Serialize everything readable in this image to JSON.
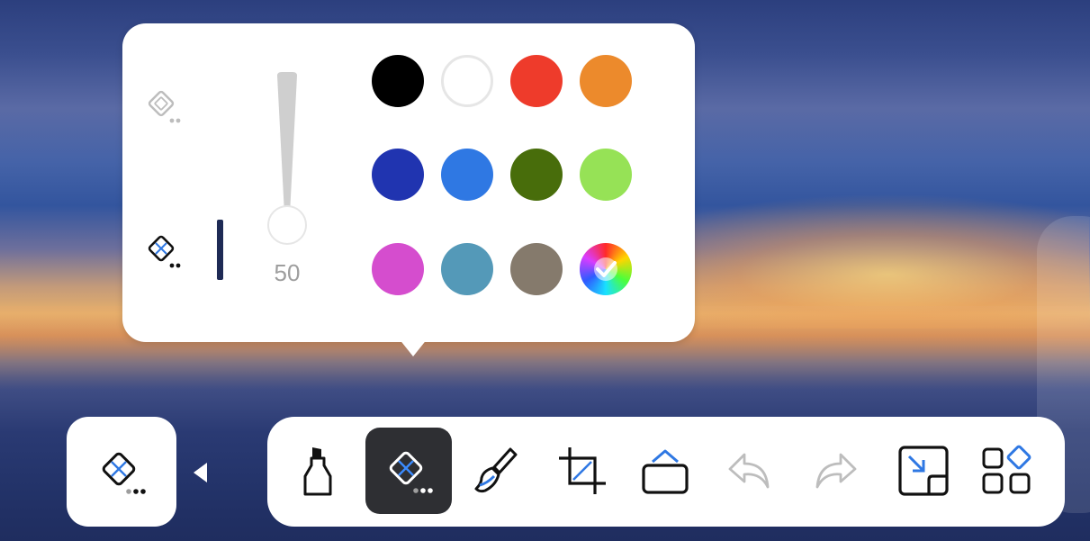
{
  "pen_panel": {
    "eraser_modes": [
      {
        "name": "area-eraser",
        "icon": "eraser-area-icon"
      },
      {
        "name": "pen-eraser",
        "icon": "eraser-x-icon",
        "selected": true
      }
    ],
    "size_value": "50",
    "size_level": 0.0,
    "colors": [
      {
        "name": "black",
        "hex": "#000000"
      },
      {
        "name": "white",
        "hex": "#ffffff"
      },
      {
        "name": "red",
        "hex": "#ee3b2b"
      },
      {
        "name": "orange",
        "hex": "#ec8a2c"
      },
      {
        "name": "navy-blue",
        "hex": "#2034b0"
      },
      {
        "name": "blue",
        "hex": "#2f78e3"
      },
      {
        "name": "dark-green",
        "hex": "#486d0b"
      },
      {
        "name": "light-green",
        "hex": "#96e256"
      },
      {
        "name": "magenta",
        "hex": "#d54dce"
      },
      {
        "name": "teal",
        "hex": "#5499b8"
      },
      {
        "name": "taupe",
        "hex": "#857a6c"
      },
      {
        "name": "custom",
        "icon": "color-wheel-icon",
        "selected": true
      }
    ]
  },
  "toolbar": {
    "current_tool_icon": "eraser-x-icon",
    "tools": [
      {
        "name": "marker",
        "icon": "marker-icon"
      },
      {
        "name": "eraser",
        "icon": "eraser-x-icon",
        "active": true
      },
      {
        "name": "brush",
        "icon": "brush-icon"
      },
      {
        "name": "crop",
        "icon": "crop-icon"
      },
      {
        "name": "shape",
        "icon": "shape-icon"
      },
      {
        "name": "undo",
        "icon": "undo-icon",
        "disabled": true
      },
      {
        "name": "redo",
        "icon": "redo-icon",
        "disabled": true
      },
      {
        "name": "minimize",
        "icon": "minimize-icon"
      },
      {
        "name": "apps",
        "icon": "apps-icon"
      }
    ]
  },
  "accent_color": "#2f78e3"
}
